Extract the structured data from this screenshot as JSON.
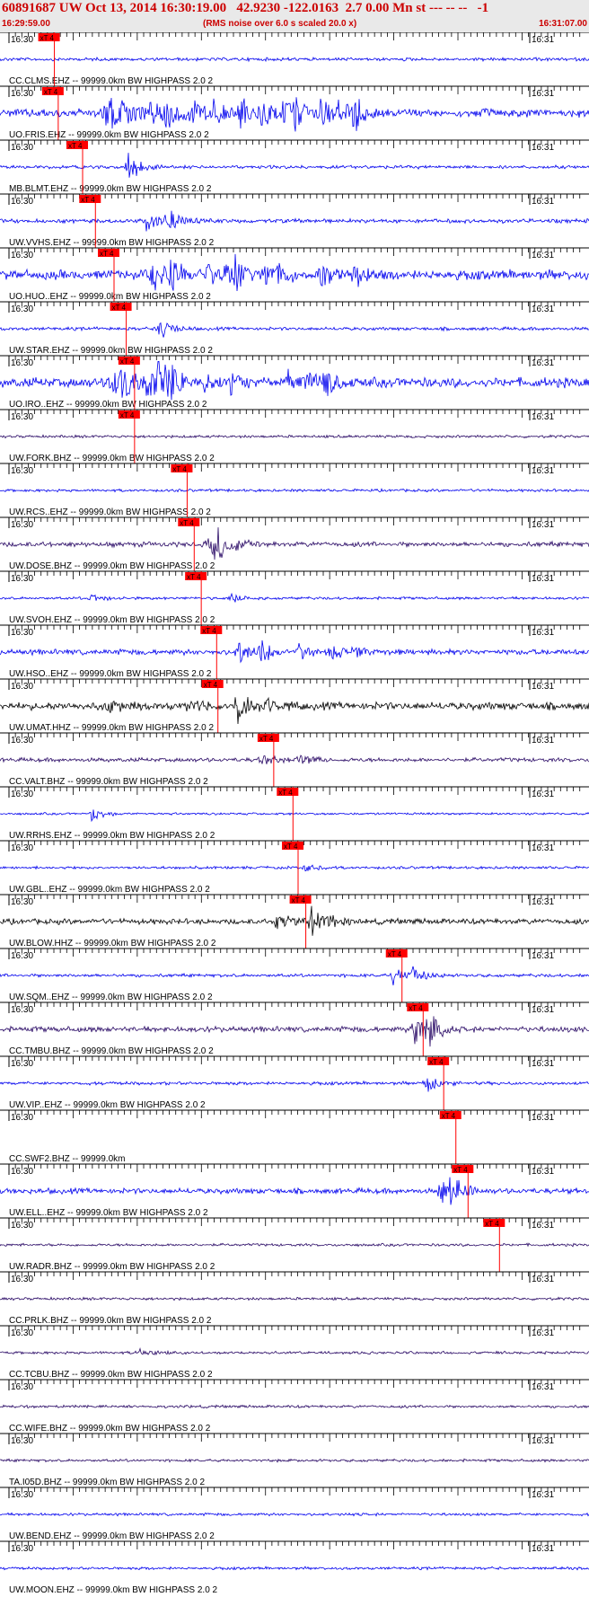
{
  "header": {
    "title": "60891687 UW Oct 13, 2014 16:30:19.00   42.9230 -122.0163  2.7 0.00 Mn st --- -- --   -1",
    "start_time": "16:29:59.00",
    "note": "(RMS noise over 6.0 s scaled 20.0 x)",
    "end_time": "16:31:07.00"
  },
  "colors": {
    "blue": "#0000ee",
    "purple": "#2a0a66",
    "black": "#000000",
    "pick": "#ff0000"
  },
  "chart_data": {
    "type": "seismogram",
    "time_start": "16:29:59.00",
    "time_end": "16:31:07.00",
    "tick_labels": [
      "16:30",
      "16:31"
    ],
    "pick_label": "xT 4",
    "traces": [
      {
        "station": "CC.CLMS.EHZ -- 99999.0km BW  HIGHPASS  2.0  2",
        "color": "blue",
        "pick": 16.6,
        "events": [],
        "amp": 0.12
      },
      {
        "station": "UO.FRIS.EHZ -- 99999.0km BW  HIGHPASS  2.0  2",
        "color": "blue",
        "pick": 17.2,
        "events": [
          [
            17.5,
            0.9
          ],
          [
            19,
            0.9
          ],
          [
            21.5,
            0.6
          ],
          [
            26,
            0.7
          ],
          [
            29,
            0.8
          ],
          [
            31,
            0.6
          ],
          [
            34,
            0.6
          ],
          [
            38,
            0.6
          ],
          [
            43,
            0.7
          ],
          [
            47,
            0.7
          ],
          [
            51,
            0.7
          ],
          [
            53,
            0.7
          ],
          [
            58,
            0.6
          ],
          [
            61,
            0.6
          ],
          [
            64,
            0.8
          ]
        ],
        "amp": 0.3
      },
      {
        "station": "MB.BLMT.EHZ -- 99999.0km BW  HIGHPASS  2.0  2",
        "color": "blue",
        "pick": 21.0,
        "events": [
          [
            22,
            0.8
          ]
        ],
        "amp": 0.12
      },
      {
        "station": "UW.VVHS.EHZ -- 99999.0km BW  HIGHPASS  2.0  2",
        "color": "blue",
        "pick": 23.0,
        "events": [
          [
            25.5,
            0.6
          ],
          [
            29.5,
            0.7
          ]
        ],
        "amp": 0.15
      },
      {
        "station": "UO.HUO..EHZ -- 99999.0km BW  HIGHPASS  2.0  2",
        "color": "blue",
        "pick": 25.9,
        "events": [
          [
            26.5,
            0.8
          ],
          [
            30,
            0.8
          ],
          [
            36,
            0.8
          ],
          [
            40,
            0.7
          ],
          [
            42,
            0.6
          ],
          [
            47,
            0.6
          ],
          [
            50,
            0.6
          ],
          [
            58,
            0.6
          ],
          [
            64,
            0.7
          ]
        ],
        "amp": 0.35
      },
      {
        "station": "UW.STAR.EHZ -- 99999.0km BW  HIGHPASS  2.0  2",
        "color": "blue",
        "pick": 27.8,
        "events": [
          [
            27.8,
            0.6
          ]
        ],
        "amp": 0.12
      },
      {
        "station": "UO.IRO..EHZ -- 99999.0km BW  HIGHPASS  2.0  2",
        "color": "blue",
        "pick": 29.1,
        "events": [
          [
            19,
            0.7
          ],
          [
            21,
            0.8
          ],
          [
            25.5,
            0.7
          ],
          [
            27.5,
            0.9
          ],
          [
            29.5,
            0.9
          ],
          [
            36,
            0.6
          ],
          [
            41,
            0.7
          ],
          [
            52,
            0.6
          ],
          [
            56,
            0.7
          ],
          [
            59,
            0.6
          ]
        ],
        "amp": 0.35
      },
      {
        "station": "UW.FORK.BHZ -- 99999.0km BW  HIGHPASS  2.0  2",
        "color": "purple",
        "pick": 29.1,
        "events": [],
        "amp": 0.1
      },
      {
        "station": "UW.RCS..EHZ -- 99999.0km BW  HIGHPASS  2.0  2",
        "color": "blue",
        "pick": 37.3,
        "events": [],
        "amp": 0.1
      },
      {
        "station": "UW.DOSE.BHZ -- 99999.0km BW  HIGHPASS  2.0  2",
        "color": "purple",
        "pick": 38.4,
        "events": [
          [
            38.3,
            0.9
          ],
          [
            36.5,
            0.3
          ],
          [
            42,
            0.3
          ]
        ],
        "amp": 0.18
      },
      {
        "station": "UW.SVOH.EHZ -- 99999.0km BW  HIGHPASS  2.0  2",
        "color": "blue",
        "pick": 39.5,
        "events": [
          [
            41,
            0.3
          ],
          [
            15,
            0.25
          ]
        ],
        "amp": 0.1
      },
      {
        "station": "UW.HSO..EHZ -- 99999.0km BW  HIGHPASS  2.0  2",
        "color": "blue",
        "pick": 41.9,
        "events": [
          [
            42.5,
            0.6
          ],
          [
            47,
            0.5
          ],
          [
            54,
            0.4
          ],
          [
            60,
            0.35
          ],
          [
            64,
            0.3
          ]
        ],
        "amp": 0.2
      },
      {
        "station": "UW.UMAT.HHZ -- 99999.0km BW  HIGHPASS  2.0  2",
        "color": "black",
        "pick": 42.1,
        "events": [
          [
            42.6,
            0.9
          ],
          [
            18,
            0.35
          ],
          [
            33,
            0.35
          ],
          [
            48,
            0.3
          ]
        ],
        "amp": 0.28
      },
      {
        "station": "CC.VALT.BHZ -- 99999.0km BW  HIGHPASS  2.0  2",
        "color": "purple",
        "pick": 50.8,
        "events": [
          [
            47,
            0.3
          ],
          [
            54,
            0.3
          ]
        ],
        "amp": 0.15
      },
      {
        "station": "UW.RRHS.EHZ -- 99999.0km BW  HIGHPASS  2.0  2",
        "color": "blue",
        "pick": 53.8,
        "events": [
          [
            15.3,
            0.4
          ]
        ],
        "amp": 0.08
      },
      {
        "station": "UW.GBL..EHZ -- 99999.0km BW  HIGHPASS  2.0  2",
        "color": "blue",
        "pick": 54.6,
        "events": [
          [
            55,
            0.2
          ]
        ],
        "amp": 0.1
      },
      {
        "station": "UW.BLOW.HHZ -- 99999.0km BW  HIGHPASS  2.0  2",
        "color": "black",
        "pick": 55.8,
        "events": [
          [
            56.3,
            0.7
          ],
          [
            49.5,
            0.45
          ],
          [
            60,
            0.3
          ]
        ],
        "amp": 0.2
      },
      {
        "station": "UW.SQM..EHZ -- 99999.0km BW  HIGHPASS  2.0  2",
        "color": "blue",
        "pick": 70.8,
        "events": [
          [
            71.5,
            0.6
          ],
          [
            75,
            0.4
          ]
        ],
        "amp": 0.12
      },
      {
        "station": "CC.TMBU.BHZ -- 99999.0km BW  HIGHPASS  2.0  2",
        "color": "purple",
        "pick": 74.1,
        "events": [
          [
            75.5,
            0.9
          ],
          [
            78,
            0.7
          ]
        ],
        "amp": 0.2
      },
      {
        "station": "UW.VIP..EHZ -- 99999.0km BW  HIGHPASS  2.0  2",
        "color": "blue",
        "pick": 77.3,
        "events": [
          [
            77.5,
            0.5
          ]
        ],
        "amp": 0.12
      },
      {
        "station": "CC.SWF2.BHZ -- 99999.0km",
        "color": "blue",
        "pick": 79.2,
        "events": [],
        "amp": 0
      },
      {
        "station": "UW.ELL..EHZ -- 99999.0km BW  HIGHPASS  2.0  2",
        "color": "blue",
        "pick": 81.1,
        "events": [
          [
            80,
            0.7
          ],
          [
            82,
            0.8
          ]
        ],
        "amp": 0.2
      },
      {
        "station": "UW.RADR.BHZ -- 99999.0km BW  HIGHPASS  2.0  2",
        "color": "purple",
        "pick": 86.0,
        "events": [],
        "amp": 0.1
      },
      {
        "station": "CC.PRLK.BHZ -- 99999.0km BW  HIGHPASS  2.0  2",
        "color": "purple",
        "pick": null,
        "events": [],
        "amp": 0.1
      },
      {
        "station": "CC.TCBU.BHZ -- 99999.0km BW  HIGHPASS  2.0  2",
        "color": "purple",
        "pick": null,
        "events": [
          [
            24,
            0.25
          ]
        ],
        "amp": 0.1
      },
      {
        "station": "CC.WIFE.BHZ -- 99999.0km BW  HIGHPASS  2.0  2",
        "color": "purple",
        "pick": null,
        "events": [],
        "amp": 0.1
      },
      {
        "station": "TA.I05D.BHZ -- 99999.0km BW  HIGHPASS  2.0  2",
        "color": "purple",
        "pick": null,
        "events": [],
        "amp": 0.1
      },
      {
        "station": "UW.BEND.EHZ -- 99999.0km BW  HIGHPASS  2.0  2",
        "color": "blue",
        "pick": null,
        "events": [],
        "amp": 0.1
      },
      {
        "station": "UW.MOON.EHZ -- 99999.0km BW  HIGHPASS  2.0  2",
        "color": "blue",
        "pick": null,
        "events": [],
        "amp": 0.1
      }
    ]
  }
}
